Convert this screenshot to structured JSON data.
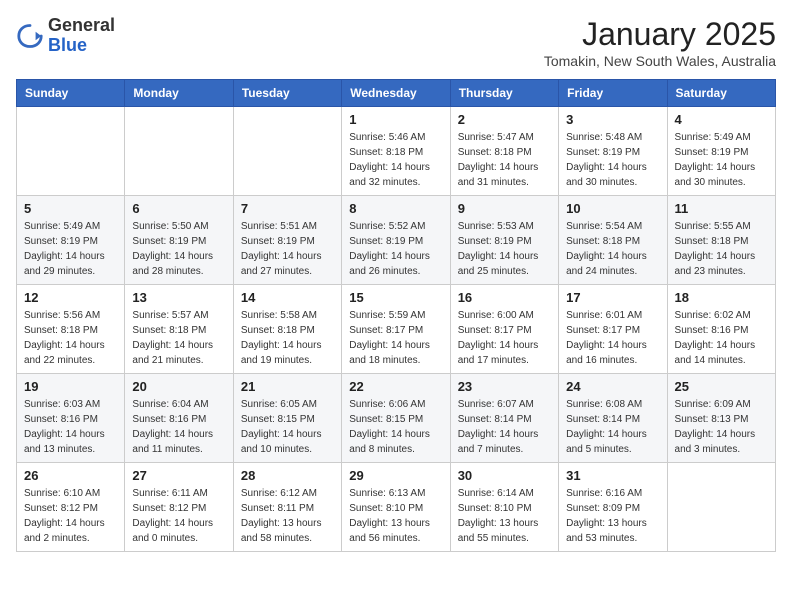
{
  "header": {
    "logo": {
      "general": "General",
      "blue": "Blue"
    },
    "month": "January 2025",
    "location": "Tomakin, New South Wales, Australia"
  },
  "weekdays": [
    "Sunday",
    "Monday",
    "Tuesday",
    "Wednesday",
    "Thursday",
    "Friday",
    "Saturday"
  ],
  "weeks": [
    [
      {
        "day": "",
        "info": ""
      },
      {
        "day": "",
        "info": ""
      },
      {
        "day": "",
        "info": ""
      },
      {
        "day": "1",
        "info": "Sunrise: 5:46 AM\nSunset: 8:18 PM\nDaylight: 14 hours\nand 32 minutes."
      },
      {
        "day": "2",
        "info": "Sunrise: 5:47 AM\nSunset: 8:18 PM\nDaylight: 14 hours\nand 31 minutes."
      },
      {
        "day": "3",
        "info": "Sunrise: 5:48 AM\nSunset: 8:19 PM\nDaylight: 14 hours\nand 30 minutes."
      },
      {
        "day": "4",
        "info": "Sunrise: 5:49 AM\nSunset: 8:19 PM\nDaylight: 14 hours\nand 30 minutes."
      }
    ],
    [
      {
        "day": "5",
        "info": "Sunrise: 5:49 AM\nSunset: 8:19 PM\nDaylight: 14 hours\nand 29 minutes."
      },
      {
        "day": "6",
        "info": "Sunrise: 5:50 AM\nSunset: 8:19 PM\nDaylight: 14 hours\nand 28 minutes."
      },
      {
        "day": "7",
        "info": "Sunrise: 5:51 AM\nSunset: 8:19 PM\nDaylight: 14 hours\nand 27 minutes."
      },
      {
        "day": "8",
        "info": "Sunrise: 5:52 AM\nSunset: 8:19 PM\nDaylight: 14 hours\nand 26 minutes."
      },
      {
        "day": "9",
        "info": "Sunrise: 5:53 AM\nSunset: 8:19 PM\nDaylight: 14 hours\nand 25 minutes."
      },
      {
        "day": "10",
        "info": "Sunrise: 5:54 AM\nSunset: 8:18 PM\nDaylight: 14 hours\nand 24 minutes."
      },
      {
        "day": "11",
        "info": "Sunrise: 5:55 AM\nSunset: 8:18 PM\nDaylight: 14 hours\nand 23 minutes."
      }
    ],
    [
      {
        "day": "12",
        "info": "Sunrise: 5:56 AM\nSunset: 8:18 PM\nDaylight: 14 hours\nand 22 minutes."
      },
      {
        "day": "13",
        "info": "Sunrise: 5:57 AM\nSunset: 8:18 PM\nDaylight: 14 hours\nand 21 minutes."
      },
      {
        "day": "14",
        "info": "Sunrise: 5:58 AM\nSunset: 8:18 PM\nDaylight: 14 hours\nand 19 minutes."
      },
      {
        "day": "15",
        "info": "Sunrise: 5:59 AM\nSunset: 8:17 PM\nDaylight: 14 hours\nand 18 minutes."
      },
      {
        "day": "16",
        "info": "Sunrise: 6:00 AM\nSunset: 8:17 PM\nDaylight: 14 hours\nand 17 minutes."
      },
      {
        "day": "17",
        "info": "Sunrise: 6:01 AM\nSunset: 8:17 PM\nDaylight: 14 hours\nand 16 minutes."
      },
      {
        "day": "18",
        "info": "Sunrise: 6:02 AM\nSunset: 8:16 PM\nDaylight: 14 hours\nand 14 minutes."
      }
    ],
    [
      {
        "day": "19",
        "info": "Sunrise: 6:03 AM\nSunset: 8:16 PM\nDaylight: 14 hours\nand 13 minutes."
      },
      {
        "day": "20",
        "info": "Sunrise: 6:04 AM\nSunset: 8:16 PM\nDaylight: 14 hours\nand 11 minutes."
      },
      {
        "day": "21",
        "info": "Sunrise: 6:05 AM\nSunset: 8:15 PM\nDaylight: 14 hours\nand 10 minutes."
      },
      {
        "day": "22",
        "info": "Sunrise: 6:06 AM\nSunset: 8:15 PM\nDaylight: 14 hours\nand 8 minutes."
      },
      {
        "day": "23",
        "info": "Sunrise: 6:07 AM\nSunset: 8:14 PM\nDaylight: 14 hours\nand 7 minutes."
      },
      {
        "day": "24",
        "info": "Sunrise: 6:08 AM\nSunset: 8:14 PM\nDaylight: 14 hours\nand 5 minutes."
      },
      {
        "day": "25",
        "info": "Sunrise: 6:09 AM\nSunset: 8:13 PM\nDaylight: 14 hours\nand 3 minutes."
      }
    ],
    [
      {
        "day": "26",
        "info": "Sunrise: 6:10 AM\nSunset: 8:12 PM\nDaylight: 14 hours\nand 2 minutes."
      },
      {
        "day": "27",
        "info": "Sunrise: 6:11 AM\nSunset: 8:12 PM\nDaylight: 14 hours\nand 0 minutes."
      },
      {
        "day": "28",
        "info": "Sunrise: 6:12 AM\nSunset: 8:11 PM\nDaylight: 13 hours\nand 58 minutes."
      },
      {
        "day": "29",
        "info": "Sunrise: 6:13 AM\nSunset: 8:10 PM\nDaylight: 13 hours\nand 56 minutes."
      },
      {
        "day": "30",
        "info": "Sunrise: 6:14 AM\nSunset: 8:10 PM\nDaylight: 13 hours\nand 55 minutes."
      },
      {
        "day": "31",
        "info": "Sunrise: 6:16 AM\nSunset: 8:09 PM\nDaylight: 13 hours\nand 53 minutes."
      },
      {
        "day": "",
        "info": ""
      }
    ]
  ]
}
